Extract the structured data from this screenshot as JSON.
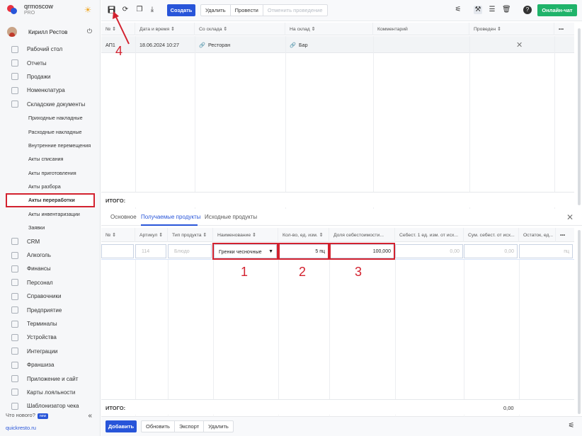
{
  "brand": {
    "name": "qrmoscow",
    "plan": "PRO"
  },
  "user": {
    "name": "Кирилл Рестов"
  },
  "nav": [
    {
      "label": "Рабочий стол",
      "sub": false
    },
    {
      "label": "Отчеты",
      "sub": false
    },
    {
      "label": "Продажи",
      "sub": false
    },
    {
      "label": "Номенклатура",
      "sub": false
    },
    {
      "label": "Складские документы",
      "sub": false
    },
    {
      "label": "Приходные накладные",
      "sub": true
    },
    {
      "label": "Расходные накладные",
      "sub": true
    },
    {
      "label": "Внутренние перемещения",
      "sub": true
    },
    {
      "label": "Акты списания",
      "sub": true
    },
    {
      "label": "Акты приготовления",
      "sub": true
    },
    {
      "label": "Акты разбора",
      "sub": true
    },
    {
      "label": "Акты переработки",
      "sub": true,
      "active": true
    },
    {
      "label": "Акты инвентаризации",
      "sub": true
    },
    {
      "label": "Заявки",
      "sub": true
    },
    {
      "label": "CRM",
      "sub": false
    },
    {
      "label": "Алкоголь",
      "sub": false
    },
    {
      "label": "Финансы",
      "sub": false
    },
    {
      "label": "Персонал",
      "sub": false
    },
    {
      "label": "Справочники",
      "sub": false
    },
    {
      "label": "Предприятие",
      "sub": false
    },
    {
      "label": "Терминалы",
      "sub": false
    },
    {
      "label": "Устройства",
      "sub": false
    },
    {
      "label": "Интеграции",
      "sub": false
    },
    {
      "label": "Франшиза",
      "sub": false
    },
    {
      "label": "Приложение и сайт",
      "sub": false
    },
    {
      "label": "Карты лояльности",
      "sub": false
    },
    {
      "label": "Шаблонизатор чека",
      "sub": false
    }
  ],
  "sidebar_footer": {
    "whats_new": "Что нового?",
    "badge": "new",
    "collapse": "«",
    "site": "quickresto.ru"
  },
  "toolbar": {
    "create": "Создать",
    "delete": "Удалить",
    "post": "Провести",
    "unpost": "Отменить проведение",
    "chat": "Онлайн-чат"
  },
  "doc_table": {
    "headers": [
      "№ ⇕",
      "Дата и время ⇕",
      "Со склада ⇕",
      "На склад ⇕",
      "Комментарий",
      "Проведен ⇕",
      "•••"
    ],
    "row": {
      "num": "АП1",
      "datetime": "18.06.2024 10:27",
      "from": "Ресторан",
      "to": "Бар",
      "comment": "",
      "posted": "✕"
    },
    "total_label": "ИТОГО:"
  },
  "tabs": {
    "basic": "Основное",
    "received": "Получаемые продукты",
    "source": "Исходные продукты",
    "close": "✕"
  },
  "product_table": {
    "headers": [
      "№ ⇕",
      "Артикул ⇕",
      "Тип продукта ⇕",
      "Наименование ⇕",
      "Кол-во, ед. изм. ⇕",
      "Доля себестоимости...",
      "Себест. 1 ед. изм. от исх...",
      "Сум. себест. от исх...",
      "Остаток, ед...",
      "•••"
    ],
    "row": {
      "article": "114",
      "type": "Блюдо",
      "name": "Гренки чесночные",
      "qty": "5 пц",
      "share": "100,000",
      "unit_cost": "0,00",
      "sum_cost": "0,00",
      "rest": "пц"
    },
    "total_label": "ИТОГО:",
    "total_value": "0,00"
  },
  "bottom": {
    "add": "Добавить",
    "refresh": "Обновить",
    "export": "Экспорт",
    "delete": "Удалить"
  },
  "annotations": [
    "1",
    "2",
    "3",
    "4"
  ]
}
